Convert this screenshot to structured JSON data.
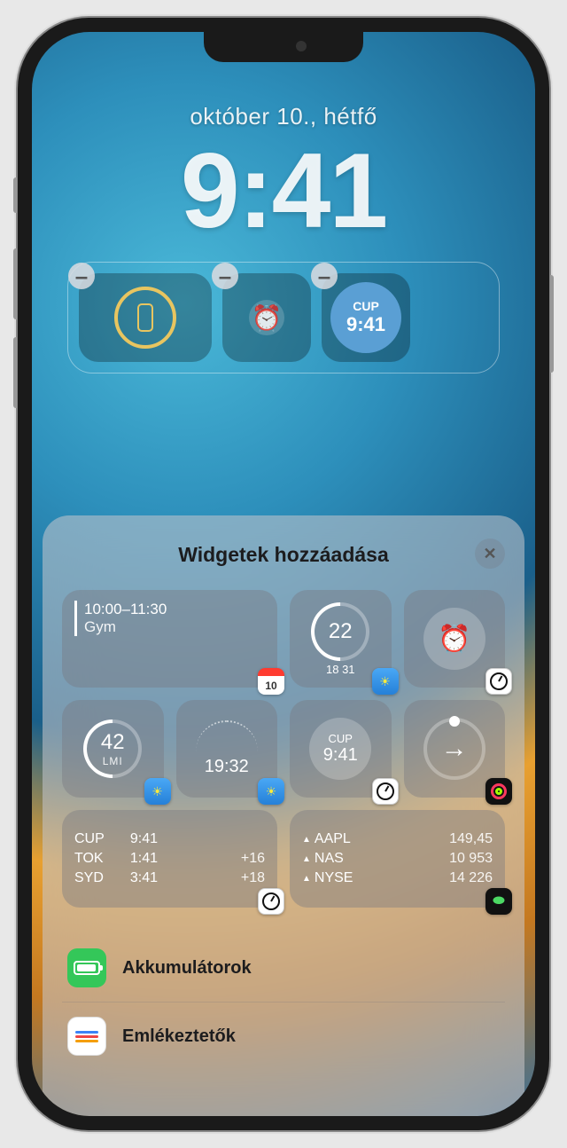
{
  "lock": {
    "date": "október 10., hétfő",
    "time": "9:41"
  },
  "current_widgets": {
    "cup": {
      "city": "CUP",
      "time": "9:41"
    }
  },
  "sheet": {
    "title": "Widgetek hozzáadása"
  },
  "suggestions": {
    "calendar": {
      "time": "10:00–11:30",
      "event": "Gym"
    },
    "temp": {
      "value": "22",
      "low": "18",
      "high": "31"
    },
    "aqi": {
      "value": "42",
      "label": "LMI"
    },
    "sun": {
      "time": "19:32"
    },
    "cup": {
      "city": "CUP",
      "time": "9:41"
    },
    "world": {
      "r1": {
        "city": "CUP",
        "time": "9:41",
        "off": ""
      },
      "r2": {
        "city": "TOK",
        "time": "1:41",
        "off": "+16"
      },
      "r3": {
        "city": "SYD",
        "time": "3:41",
        "off": "+18"
      }
    },
    "stocks": {
      "r1": {
        "t": "AAPL",
        "v": "149,45"
      },
      "r2": {
        "t": "NAS",
        "v": "10 953"
      },
      "r3": {
        "t": "NYSE",
        "v": "14 226"
      }
    }
  },
  "app_list": {
    "battery": "Akkumulátorok",
    "reminders": "Emlékeztetők"
  }
}
